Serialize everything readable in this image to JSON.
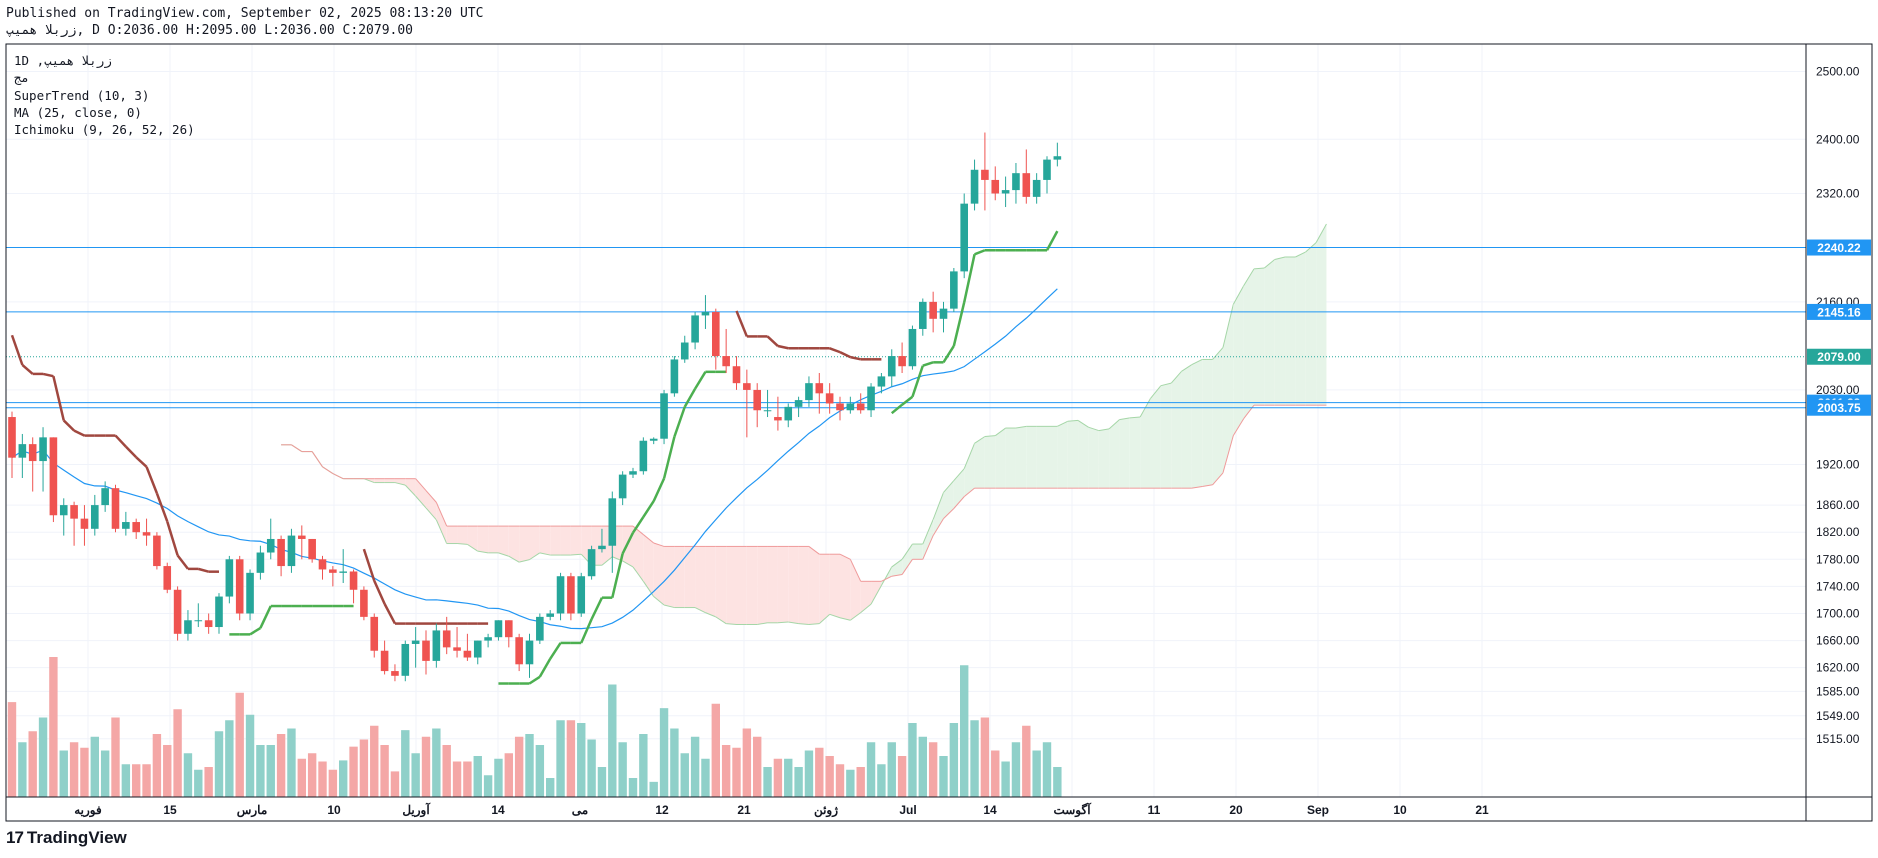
{
  "header": {
    "line1": "Published on TradingView.com, September 02, 2025 08:13:20 UTC",
    "line2": "زربلا همیپ, D O:2036.00 H:2095.00 L:2036.00 C:2079.00"
  },
  "legend": {
    "symbol": "1D ,زربلا همیپ",
    "sub": "مج",
    "supertrend": "SuperTrend (10, 3)",
    "ma": "MA (25, close, 0)",
    "ichimoku": "Ichimoku (9, 26, 52, 26)"
  },
  "footer": {
    "brand": "TradingView",
    "mark": "17"
  },
  "colors": {
    "up": "#26a69a",
    "down": "#ef5350",
    "supertrend_up": "#4caf50",
    "supertrend_down": "#a0473f",
    "ma": "#2196f3",
    "hline": "#2196f3",
    "cloud_green": "#e6f4e8",
    "cloud_red": "#fde3e2",
    "last": "#26a69a"
  },
  "chart_data": {
    "type": "candlestick",
    "timeframe": "1D",
    "x_tick_labels": [
      "فوریه",
      "15",
      "مارس",
      "10",
      "آوریل",
      "14",
      "می",
      "12",
      "21",
      "ژوئن",
      "Jul",
      "14",
      "آگوست",
      "11",
      "20",
      "Sep",
      "10",
      "21"
    ],
    "price_axis_labels": [
      "2500.00",
      "2400.00",
      "2320.00",
      "2160.00",
      "2030.00",
      "1920.00",
      "1860.00",
      "1820.00",
      "1780.00",
      "1740.00",
      "1700.00",
      "1660.00",
      "1620.00",
      "1585.00",
      "1549.00",
      "1515.00"
    ],
    "price_badges": [
      {
        "label": "2240.22",
        "value": 2240.22,
        "color": "#2196f3"
      },
      {
        "label": "2145.16",
        "value": 2145.16,
        "color": "#2196f3"
      },
      {
        "label": "2079.00",
        "value": 2079.0,
        "color": "#26a69a"
      },
      {
        "label": "2011.23",
        "value": 2011.23,
        "color": "#2196f3"
      },
      {
        "label": "2003.75",
        "value": 2003.75,
        "color": "#2196f3"
      }
    ],
    "candles": [
      [
        1990,
        1998,
        1900,
        1930
      ],
      [
        1930,
        1965,
        1900,
        1950
      ],
      [
        1950,
        1960,
        1880,
        1925
      ],
      [
        1925,
        1975,
        1880,
        1960
      ],
      [
        1960,
        1960,
        1835,
        1845
      ],
      [
        1845,
        1870,
        1815,
        1860
      ],
      [
        1860,
        1865,
        1800,
        1840
      ],
      [
        1840,
        1860,
        1800,
        1825
      ],
      [
        1825,
        1875,
        1815,
        1860
      ],
      [
        1860,
        1895,
        1850,
        1885
      ],
      [
        1885,
        1890,
        1820,
        1825
      ],
      [
        1825,
        1850,
        1815,
        1835
      ],
      [
        1835,
        1840,
        1810,
        1820
      ],
      [
        1820,
        1840,
        1800,
        1815
      ],
      [
        1815,
        1820,
        1765,
        1770
      ],
      [
        1770,
        1775,
        1730,
        1735
      ],
      [
        1735,
        1740,
        1660,
        1670
      ],
      [
        1670,
        1705,
        1660,
        1690
      ],
      [
        1690,
        1715,
        1680,
        1690
      ],
      [
        1690,
        1700,
        1670,
        1680
      ],
      [
        1680,
        1730,
        1670,
        1725
      ],
      [
        1725,
        1785,
        1715,
        1780
      ],
      [
        1780,
        1785,
        1690,
        1700
      ],
      [
        1700,
        1765,
        1690,
        1760
      ],
      [
        1760,
        1800,
        1750,
        1790
      ],
      [
        1790,
        1840,
        1780,
        1810
      ],
      [
        1810,
        1815,
        1755,
        1770
      ],
      [
        1770,
        1825,
        1760,
        1815
      ],
      [
        1815,
        1830,
        1780,
        1810
      ],
      [
        1810,
        1810,
        1775,
        1780
      ],
      [
        1780,
        1785,
        1750,
        1765
      ],
      [
        1765,
        1770,
        1740,
        1760
      ],
      [
        1760,
        1795,
        1745,
        1762
      ],
      [
        1762,
        1765,
        1715,
        1735
      ],
      [
        1735,
        1740,
        1690,
        1695
      ],
      [
        1695,
        1700,
        1635,
        1645
      ],
      [
        1645,
        1660,
        1610,
        1615
      ],
      [
        1615,
        1625,
        1600,
        1608
      ],
      [
        1608,
        1660,
        1600,
        1655
      ],
      [
        1655,
        1680,
        1620,
        1660
      ],
      [
        1660,
        1675,
        1610,
        1630
      ],
      [
        1630,
        1685,
        1620,
        1675
      ],
      [
        1675,
        1695,
        1640,
        1650
      ],
      [
        1650,
        1680,
        1635,
        1645
      ],
      [
        1645,
        1670,
        1630,
        1635
      ],
      [
        1635,
        1660,
        1625,
        1660
      ],
      [
        1660,
        1670,
        1650,
        1665
      ],
      [
        1665,
        1690,
        1660,
        1690
      ],
      [
        1690,
        1690,
        1650,
        1665
      ],
      [
        1665,
        1670,
        1615,
        1625
      ],
      [
        1625,
        1670,
        1605,
        1660
      ],
      [
        1660,
        1700,
        1655,
        1695
      ],
      [
        1695,
        1705,
        1690,
        1700
      ],
      [
        1700,
        1760,
        1690,
        1755
      ],
      [
        1755,
        1760,
        1690,
        1700
      ],
      [
        1700,
        1760,
        1695,
        1755
      ],
      [
        1755,
        1800,
        1750,
        1795
      ],
      [
        1795,
        1825,
        1790,
        1800
      ],
      [
        1800,
        1880,
        1760,
        1870
      ],
      [
        1870,
        1910,
        1860,
        1905
      ],
      [
        1905,
        1915,
        1900,
        1910
      ],
      [
        1910,
        1960,
        1905,
        1955
      ],
      [
        1955,
        1960,
        1950,
        1958
      ],
      [
        1958,
        2030,
        1950,
        2025
      ],
      [
        2025,
        2080,
        2020,
        2075
      ],
      [
        2075,
        2110,
        2070,
        2100
      ],
      [
        2100,
        2145,
        2090,
        2140
      ],
      [
        2140,
        2170,
        2120,
        2145
      ],
      [
        2145,
        2150,
        2060,
        2080
      ],
      [
        2080,
        2120,
        2055,
        2065
      ],
      [
        2065,
        2080,
        2030,
        2040
      ],
      [
        2040,
        2060,
        1960,
        2030
      ],
      [
        2030,
        2040,
        1975,
        2000
      ],
      [
        2000,
        2030,
        1990,
        2000
      ],
      [
        1990,
        2020,
        1970,
        1985
      ],
      [
        1985,
        2010,
        1975,
        2005
      ],
      [
        2005,
        2020,
        1990,
        2015
      ],
      [
        2015,
        2050,
        2005,
        2040
      ],
      [
        2040,
        2055,
        1995,
        2025
      ],
      [
        2025,
        2040,
        1995,
        2010
      ],
      [
        2010,
        2020,
        1985,
        2000
      ],
      [
        2000,
        2020,
        1995,
        2010
      ],
      [
        2010,
        2025,
        1995,
        2000
      ],
      [
        2000,
        2040,
        1990,
        2035
      ],
      [
        2035,
        2055,
        2025,
        2050
      ],
      [
        2050,
        2090,
        2035,
        2080
      ],
      [
        2080,
        2100,
        2055,
        2065
      ],
      [
        2065,
        2125,
        2060,
        2120
      ],
      [
        2120,
        2165,
        2110,
        2160
      ],
      [
        2160,
        2175,
        2115,
        2135
      ],
      [
        2135,
        2160,
        2115,
        2150
      ],
      [
        2150,
        2210,
        2145,
        2205
      ],
      [
        2205,
        2320,
        2195,
        2305
      ],
      [
        2305,
        2370,
        2295,
        2355
      ],
      [
        2355,
        2410,
        2295,
        2340
      ],
      [
        2340,
        2360,
        2310,
        2320
      ],
      [
        2320,
        2345,
        2300,
        2325
      ],
      [
        2325,
        2365,
        2305,
        2350
      ],
      [
        2350,
        2385,
        2305,
        2315
      ],
      [
        2315,
        2350,
        2305,
        2340
      ],
      [
        2340,
        2375,
        2320,
        2370
      ],
      [
        2370,
        2395,
        2360,
        2375
      ]
    ],
    "x_ranges_note": "dates run from late January 2025 to early September 2025",
    "y_range": [
      1500,
      2520
    ],
    "grid": true
  }
}
